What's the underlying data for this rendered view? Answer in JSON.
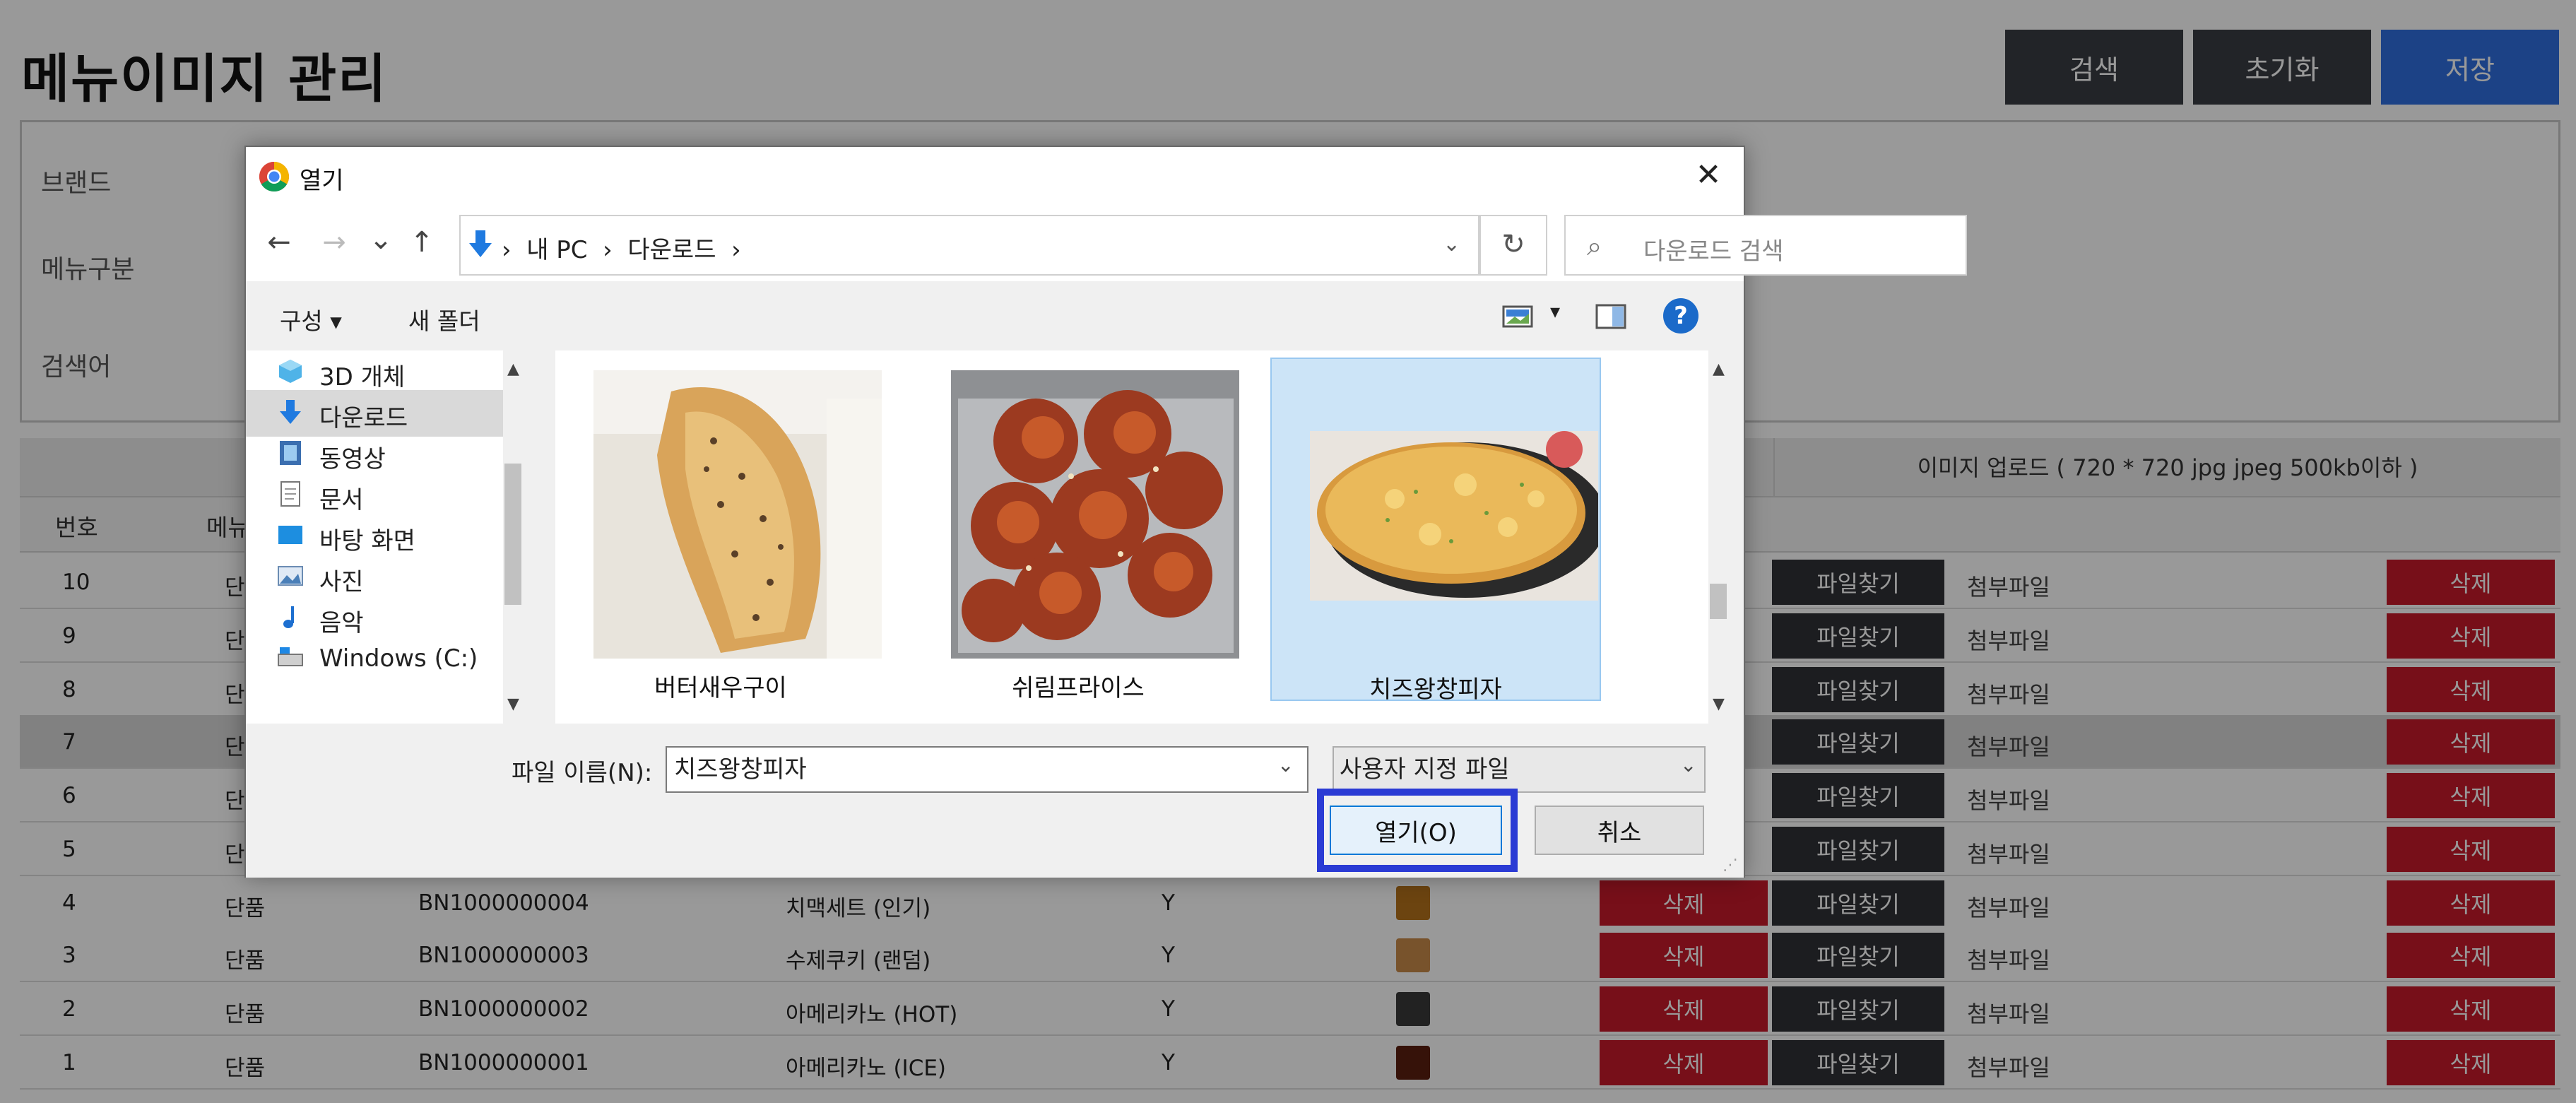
{
  "page": {
    "title": "메뉴이미지 관리",
    "buttons": {
      "search": "검색",
      "reset": "초기화",
      "save": "저장"
    },
    "filters": {
      "brand_label": "브랜드",
      "menu_type_label": "메뉴구분",
      "keyword_label": "검색어"
    },
    "upload_header": "이미지 업로드 ( 720 * 720 jpg jpeg 500kb이하 )",
    "columns": {
      "no": "번호",
      "menu": "메뉴"
    },
    "delete_label": "삭제",
    "find_label": "파일찾기",
    "attach_label": "첨부파일",
    "rows": [
      {
        "no": "10",
        "type": "단"
      },
      {
        "no": "9",
        "type": "단"
      },
      {
        "no": "8",
        "type": "단"
      },
      {
        "no": "7",
        "type": "단"
      },
      {
        "no": "6",
        "type": "단"
      },
      {
        "no": "5",
        "type": "단"
      },
      {
        "no": "4",
        "type": "단품",
        "code": "BN1000000004",
        "name": "치맥세트 (인기)",
        "use": "Y"
      },
      {
        "no": "3",
        "type": "단품",
        "code": "BN1000000003",
        "name": "수제쿠키 (랜덤)",
        "use": "Y"
      },
      {
        "no": "2",
        "type": "단품",
        "code": "BN1000000002",
        "name": "아메리카노 (HOT)",
        "use": "Y"
      },
      {
        "no": "1",
        "type": "단품",
        "code": "BN1000000001",
        "name": "아메리카노 (ICE)",
        "use": "Y"
      }
    ]
  },
  "dialog": {
    "title": "열기",
    "close": "✕",
    "nav": {
      "back": "←",
      "forward": "→",
      "recent": "⌄",
      "up": "↑"
    },
    "address_text": "›  내 PC  ›  다운로드  ›",
    "refresh": "↻",
    "search_placeholder": "다운로드 검색",
    "toolbar": {
      "organize": "구성 ▾",
      "new_folder": "새 폴더",
      "help": "?"
    },
    "nav_items": [
      {
        "label": "3D 개체",
        "icon": "cube-icon"
      },
      {
        "label": "다운로드",
        "icon": "download-arrow-icon"
      },
      {
        "label": "동영상",
        "icon": "video-icon"
      },
      {
        "label": "문서",
        "icon": "document-icon"
      },
      {
        "label": "바탕 화면",
        "icon": "desktop-icon"
      },
      {
        "label": "사진",
        "icon": "pictures-icon"
      },
      {
        "label": "음악",
        "icon": "music-icon"
      },
      {
        "label": "Windows (C:)",
        "icon": "drive-icon"
      }
    ],
    "files": [
      {
        "name": "버터새우구이"
      },
      {
        "name": "쉬림프라이스"
      },
      {
        "name": "치즈왕창피자"
      }
    ],
    "filename_label": "파일 이름(N):",
    "filename_value": "치즈왕창피자",
    "filter_value": "사용자 지정 파일",
    "open_label": "열기(O)",
    "cancel_label": "취소",
    "colors": {
      "accent": "#0078d7",
      "highlight": "#2b3bd4",
      "delete": "#c7192a",
      "save": "#2f6fe0"
    }
  }
}
